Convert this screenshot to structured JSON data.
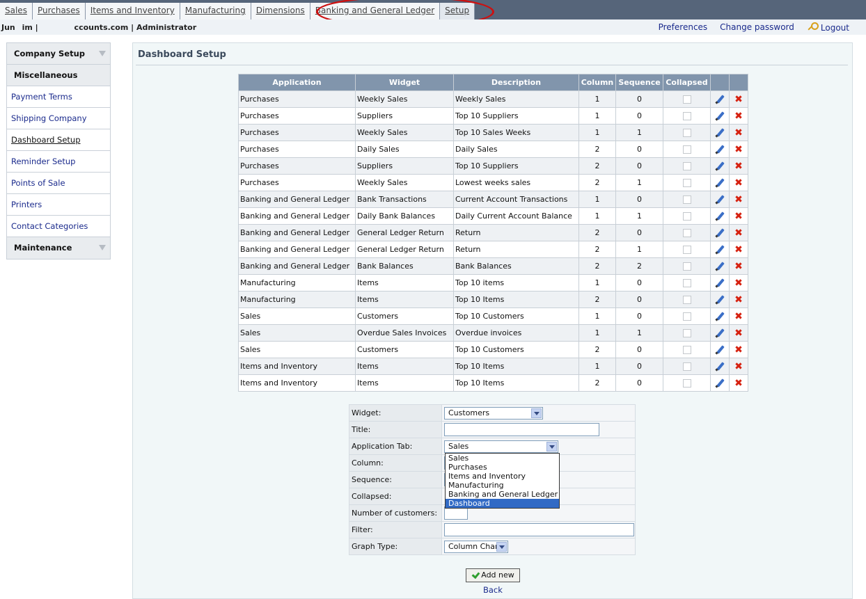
{
  "top_nav": {
    "tabs": [
      "Sales",
      "Purchases",
      "Items and Inventory",
      "Manufacturing",
      "Dimensions",
      "Banking and General Ledger",
      "Setup"
    ],
    "active": "Setup"
  },
  "info_bar": {
    "left_1": "Jun",
    "left_2": "im |",
    "left_3": "ccounts.com | Administrator",
    "preferences": "Preferences",
    "change_password": "Change password",
    "logout": "Logout"
  },
  "sidebar": {
    "company_setup": "Company Setup",
    "miscellaneous": "Miscellaneous",
    "items": [
      "Payment Terms",
      "Shipping Company",
      "Dashboard Setup",
      "Reminder Setup",
      "Points of Sale",
      "Printers",
      "Contact Categories"
    ],
    "current": "Dashboard Setup",
    "maintenance": "Maintenance"
  },
  "page_title": "Dashboard Setup",
  "table": {
    "headers": [
      "Application",
      "Widget",
      "Description",
      "Column",
      "Sequence",
      "Collapsed",
      "",
      ""
    ],
    "rows": [
      [
        "Purchases",
        "Weekly Sales",
        "Weekly Sales",
        "1",
        "0"
      ],
      [
        "Purchases",
        "Suppliers",
        "Top 10 Suppliers",
        "1",
        "0"
      ],
      [
        "Purchases",
        "Weekly Sales",
        "Top 10 Sales Weeks",
        "1",
        "1"
      ],
      [
        "Purchases",
        "Daily Sales",
        "Daily Sales",
        "2",
        "0"
      ],
      [
        "Purchases",
        "Suppliers",
        "Top 10 Suppliers",
        "2",
        "0"
      ],
      [
        "Purchases",
        "Weekly Sales",
        "Lowest weeks sales",
        "2",
        "1"
      ],
      [
        "Banking and General Ledger",
        "Bank Transactions",
        "Current Account Transactions",
        "1",
        "0"
      ],
      [
        "Banking and General Ledger",
        "Daily Bank Balances",
        "Daily Current Account Balance",
        "1",
        "1"
      ],
      [
        "Banking and General Ledger",
        "General Ledger Return",
        "Return",
        "2",
        "0"
      ],
      [
        "Banking and General Ledger",
        "General Ledger Return",
        "Return",
        "2",
        "1"
      ],
      [
        "Banking and General Ledger",
        "Bank Balances",
        "Bank Balances",
        "2",
        "2"
      ],
      [
        "Manufacturing",
        "Items",
        "Top 10 items",
        "1",
        "0"
      ],
      [
        "Manufacturing",
        "Items",
        "Top 10 Items",
        "2",
        "0"
      ],
      [
        "Sales",
        "Customers",
        "Top 10 Customers",
        "1",
        "0"
      ],
      [
        "Sales",
        "Overdue Sales Invoices",
        "Overdue invoices",
        "1",
        "1"
      ],
      [
        "Sales",
        "Customers",
        "Top 10 Customers",
        "2",
        "0"
      ],
      [
        "Items and Inventory",
        "Items",
        "Top 10 Items",
        "1",
        "0"
      ],
      [
        "Items and Inventory",
        "Items",
        "Top 10 Items",
        "2",
        "0"
      ]
    ]
  },
  "form": {
    "widget_label": "Widget:",
    "widget_value": "Customers",
    "title_label": "Title:",
    "title_value": "",
    "app_tab_label": "Application Tab:",
    "app_tab_value": "Sales",
    "column_label": "Column:",
    "sequence_label": "Sequence:",
    "collapsed_label": "Collapsed:",
    "num_customers_label": "Number of customers:",
    "filter_label": "Filter:",
    "filter_value": "",
    "graph_type_label": "Graph Type:",
    "graph_type_value": "Column Chart",
    "app_tab_options": [
      "Sales",
      "Purchases",
      "Items and Inventory",
      "Manufacturing",
      "Banking and General Ledger",
      "Dashboard"
    ],
    "app_tab_highlighted": "Dashboard"
  },
  "buttons": {
    "add_new": "Add new",
    "back": "Back"
  }
}
